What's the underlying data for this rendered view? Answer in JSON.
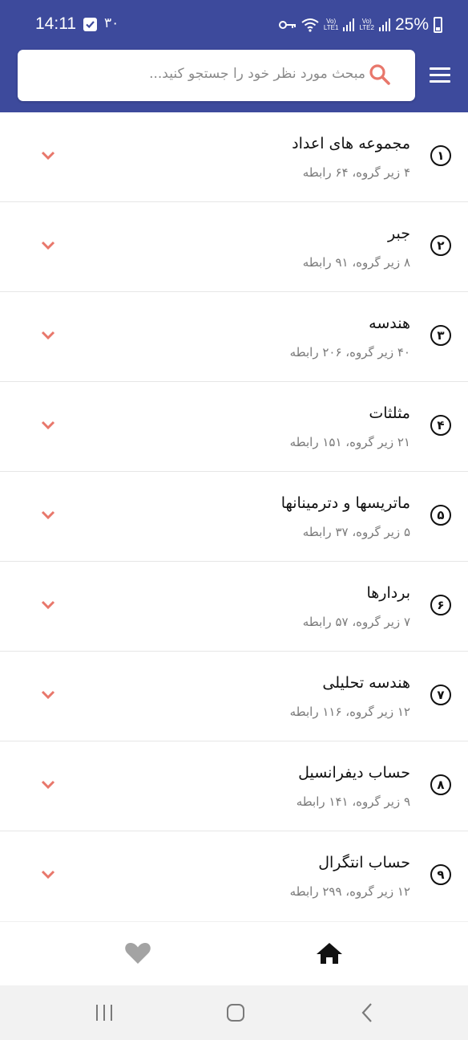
{
  "status_bar": {
    "time": "14:11",
    "notification_text": "۳۰",
    "battery_percent": "25%",
    "sim1_label": [
      "Vo)",
      "LTE1"
    ],
    "sim2_label": [
      "Vo)",
      "LTE2"
    ]
  },
  "search": {
    "placeholder": "مبحث مورد نظر خود را جستجو کنید..."
  },
  "colors": {
    "header": "#3d4a9c",
    "accent_search_icon": "#e8776b",
    "chevron": "#e8776b"
  },
  "topics": [
    {
      "number": "۱",
      "title": "مجموعه های اعداد",
      "subtitle": "۴ زیر گروه، ۶۴ رابطه"
    },
    {
      "number": "۲",
      "title": "جبر",
      "subtitle": "۸ زیر گروه، ۹۱ رابطه"
    },
    {
      "number": "۳",
      "title": "هندسه",
      "subtitle": "۴۰ زیر گروه، ۲۰۶ رابطه"
    },
    {
      "number": "۴",
      "title": "مثلثات",
      "subtitle": "۲۱ زیر گروه، ۱۵۱ رابطه"
    },
    {
      "number": "۵",
      "title": "ماتریسها و دترمینانها",
      "subtitle": "۵ زیر گروه، ۳۷ رابطه"
    },
    {
      "number": "۶",
      "title": "بردارها",
      "subtitle": "۷ زیر گروه، ۵۷ رابطه"
    },
    {
      "number": "۷",
      "title": "هندسه تحلیلی",
      "subtitle": "۱۲ زیر گروه، ۱۱۶ رابطه"
    },
    {
      "number": "۸",
      "title": "حساب دیفرانسیل",
      "subtitle": "۹ زیر گروه، ۱۴۱ رابطه"
    },
    {
      "number": "۹",
      "title": "حساب انتگرال",
      "subtitle": "۱۲ زیر گروه، ۲۹۹ رابطه"
    }
  ],
  "bottom_nav": {
    "items": [
      {
        "icon": "home-icon",
        "active": true
      },
      {
        "icon": "heart-icon",
        "active": false
      }
    ]
  },
  "system_nav": {
    "buttons": [
      "recents-icon",
      "home-button-icon",
      "back-icon"
    ]
  }
}
